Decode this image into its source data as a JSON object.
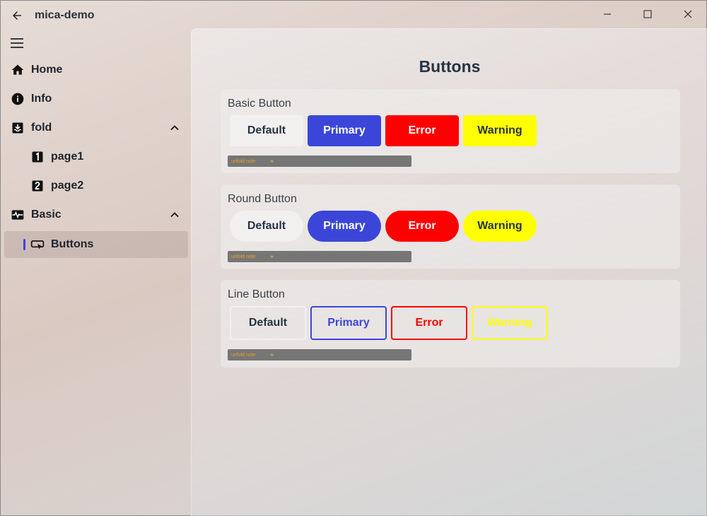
{
  "app": {
    "title": "mica-demo"
  },
  "colors": {
    "primary": "#3b46d8",
    "error": "#ff0000",
    "warning": "#ffff00",
    "default_bg": "#f2f0ef",
    "text_dark": "#263445"
  },
  "sidebar": {
    "items": [
      {
        "label": "Home",
        "icon": "home-icon"
      },
      {
        "label": "Info",
        "icon": "info-icon"
      },
      {
        "label": "fold",
        "icon": "inbox-download-icon",
        "expanded": true
      },
      {
        "label": "page1",
        "icon": "numeric-1-box-icon"
      },
      {
        "label": "page2",
        "icon": "numeric-2-box-icon"
      },
      {
        "label": "Basic",
        "icon": "pulse-icon",
        "expanded": true
      },
      {
        "label": "Buttons",
        "icon": "button-cursor-icon",
        "active": true
      }
    ]
  },
  "main": {
    "title": "Buttons",
    "cards": [
      {
        "title": "Basic Button",
        "buttons": [
          "Default",
          "Primary",
          "Error",
          "Warning"
        ],
        "note": {
          "label": "unfold note",
          "arrow": "›››"
        }
      },
      {
        "title": "Round Button",
        "buttons": [
          "Default",
          "Primary",
          "Error",
          "Warning"
        ],
        "note": {
          "label": "unfold note",
          "arrow": "›››"
        }
      },
      {
        "title": "Line Button",
        "buttons": [
          "Default",
          "Primary",
          "Error",
          "Warning"
        ],
        "note": {
          "label": "unfold note",
          "arrow": "›››"
        }
      }
    ]
  }
}
